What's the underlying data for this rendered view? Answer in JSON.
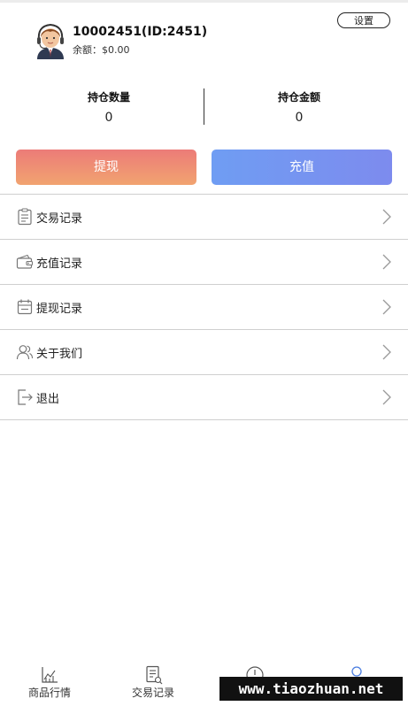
{
  "profile": {
    "username": "10002451(ID:2451)",
    "balance": "余额：$0.00",
    "settings_label": "设置"
  },
  "stats": {
    "position_count_label": "持仓数量",
    "position_count_value": "0",
    "position_amount_label": "持仓金额",
    "position_amount_value": "0"
  },
  "actions": {
    "withdraw_label": "提现",
    "recharge_label": "充值"
  },
  "menu": {
    "items": [
      {
        "label": "交易记录",
        "icon": "clipboard-icon"
      },
      {
        "label": "充值记录",
        "icon": "wallet-icon"
      },
      {
        "label": "提现记录",
        "icon": "calendar-icon"
      },
      {
        "label": "关于我们",
        "icon": "users-icon"
      },
      {
        "label": "退出",
        "icon": "logout-icon"
      }
    ]
  },
  "bottom_nav": {
    "items": [
      {
        "label": "商品行情",
        "icon": "chart-icon"
      },
      {
        "label": "交易记录",
        "icon": "document-icon"
      },
      {
        "label": "",
        "icon": "clock-icon"
      },
      {
        "label": "",
        "icon": "user-icon"
      }
    ]
  },
  "watermark": "www.tiaozhuan.net"
}
